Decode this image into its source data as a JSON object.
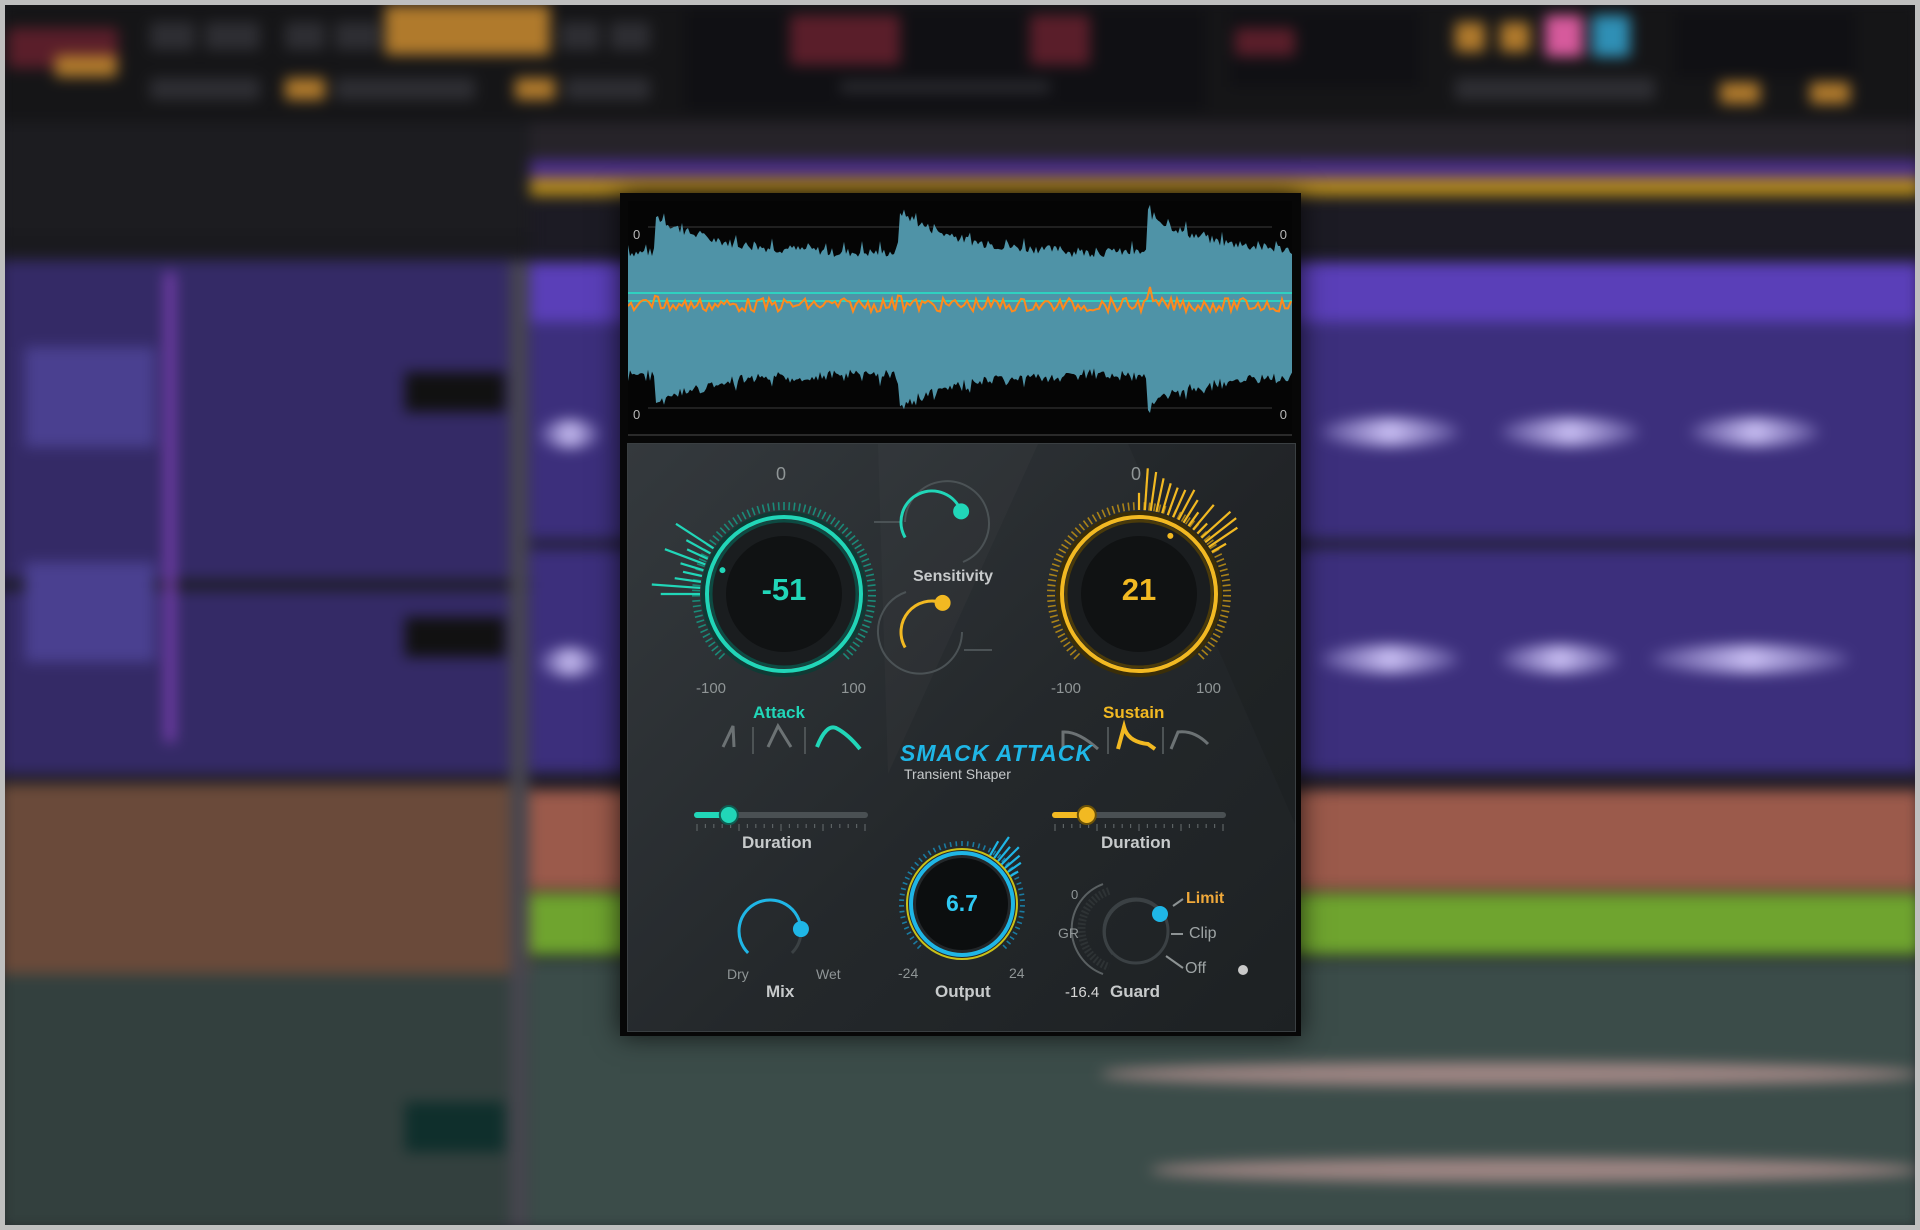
{
  "plugin": {
    "brand_name": "SMACK ATTACK",
    "subtitle": "Transient Shaper",
    "scope": {
      "scale_label": "0"
    },
    "attack": {
      "label": "Attack",
      "value": "-51",
      "min_label": "-100",
      "max_label": "100",
      "center_label": "0",
      "value_fraction": 0.245,
      "color": "#21d6b8"
    },
    "sustain": {
      "label": "Sustain",
      "value": "21",
      "min_label": "-100",
      "max_label": "100",
      "center_label": "0",
      "value_fraction": 0.605,
      "color": "#f2b922"
    },
    "sensitivity": {
      "label": "Sensitivity"
    },
    "attack_shapes": {
      "selected_index": 2
    },
    "sustain_shapes": {
      "selected_index": 1
    },
    "attack_duration": {
      "label": "Duration",
      "value_fraction": 0.2
    },
    "sustain_duration": {
      "label": "Duration",
      "value_fraction": 0.2
    },
    "mix": {
      "label": "Mix",
      "min_label": "Dry",
      "max_label": "Wet",
      "value_fraction": 0.82
    },
    "output": {
      "label": "Output",
      "value": "6.7",
      "min_label": "-24",
      "max_label": "24",
      "value_fraction": 0.64
    },
    "guard": {
      "label": "Guard",
      "gr_label": "GR",
      "gr_top_label": "0",
      "gr_value": "-16.4",
      "options": [
        "Limit",
        "Clip",
        "Off"
      ],
      "selected": "Limit"
    }
  },
  "colors": {
    "attack": "#21d6b8",
    "sustain": "#f2b922",
    "accent": "#1fb6e6",
    "waveform": "#4f93a7",
    "envelope": "#ff8a1c"
  }
}
